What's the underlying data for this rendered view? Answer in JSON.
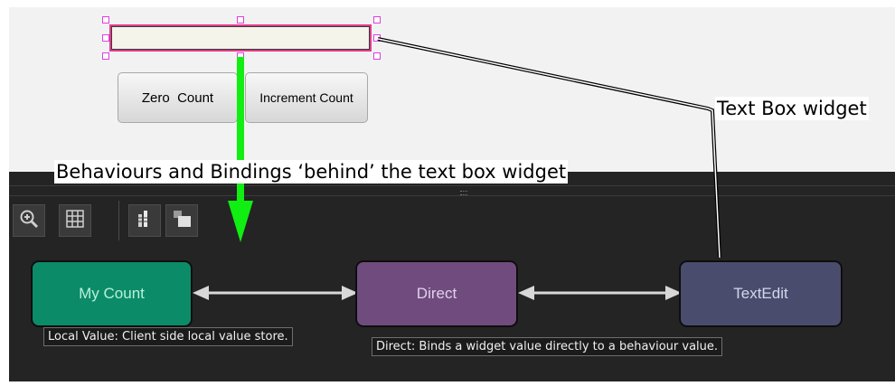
{
  "widget_canvas": {
    "text_box_value": "",
    "buttons": [
      {
        "label": "Zero  Count"
      },
      {
        "label": "Increment Count"
      }
    ]
  },
  "callouts": {
    "text_box_widget": "Text Box widget",
    "behaviours_bindings": "Behaviours and Bindings ‘behind’ the text box widget"
  },
  "toolbar": {
    "tools": [
      {
        "icon": "zoom-in-icon"
      },
      {
        "icon": "grid-icon"
      },
      {
        "icon": "align-icon"
      },
      {
        "icon": "layers-icon"
      }
    ]
  },
  "graph": {
    "nodes": [
      {
        "label": "My Count",
        "color": "#0c8b68"
      },
      {
        "label": "Direct",
        "color": "#6f4b7e"
      },
      {
        "label": "TextEdit",
        "color": "#4a4c6e"
      }
    ],
    "tooltips": {
      "local_value": "Local Value: Client side local value store.",
      "direct": "Direct: Binds a widget value directly to a behaviour value."
    }
  },
  "colors": {
    "arrow_green": "#11ee11",
    "selection_pink": "#e23a8a",
    "handle_magenta": "#e03de0"
  }
}
